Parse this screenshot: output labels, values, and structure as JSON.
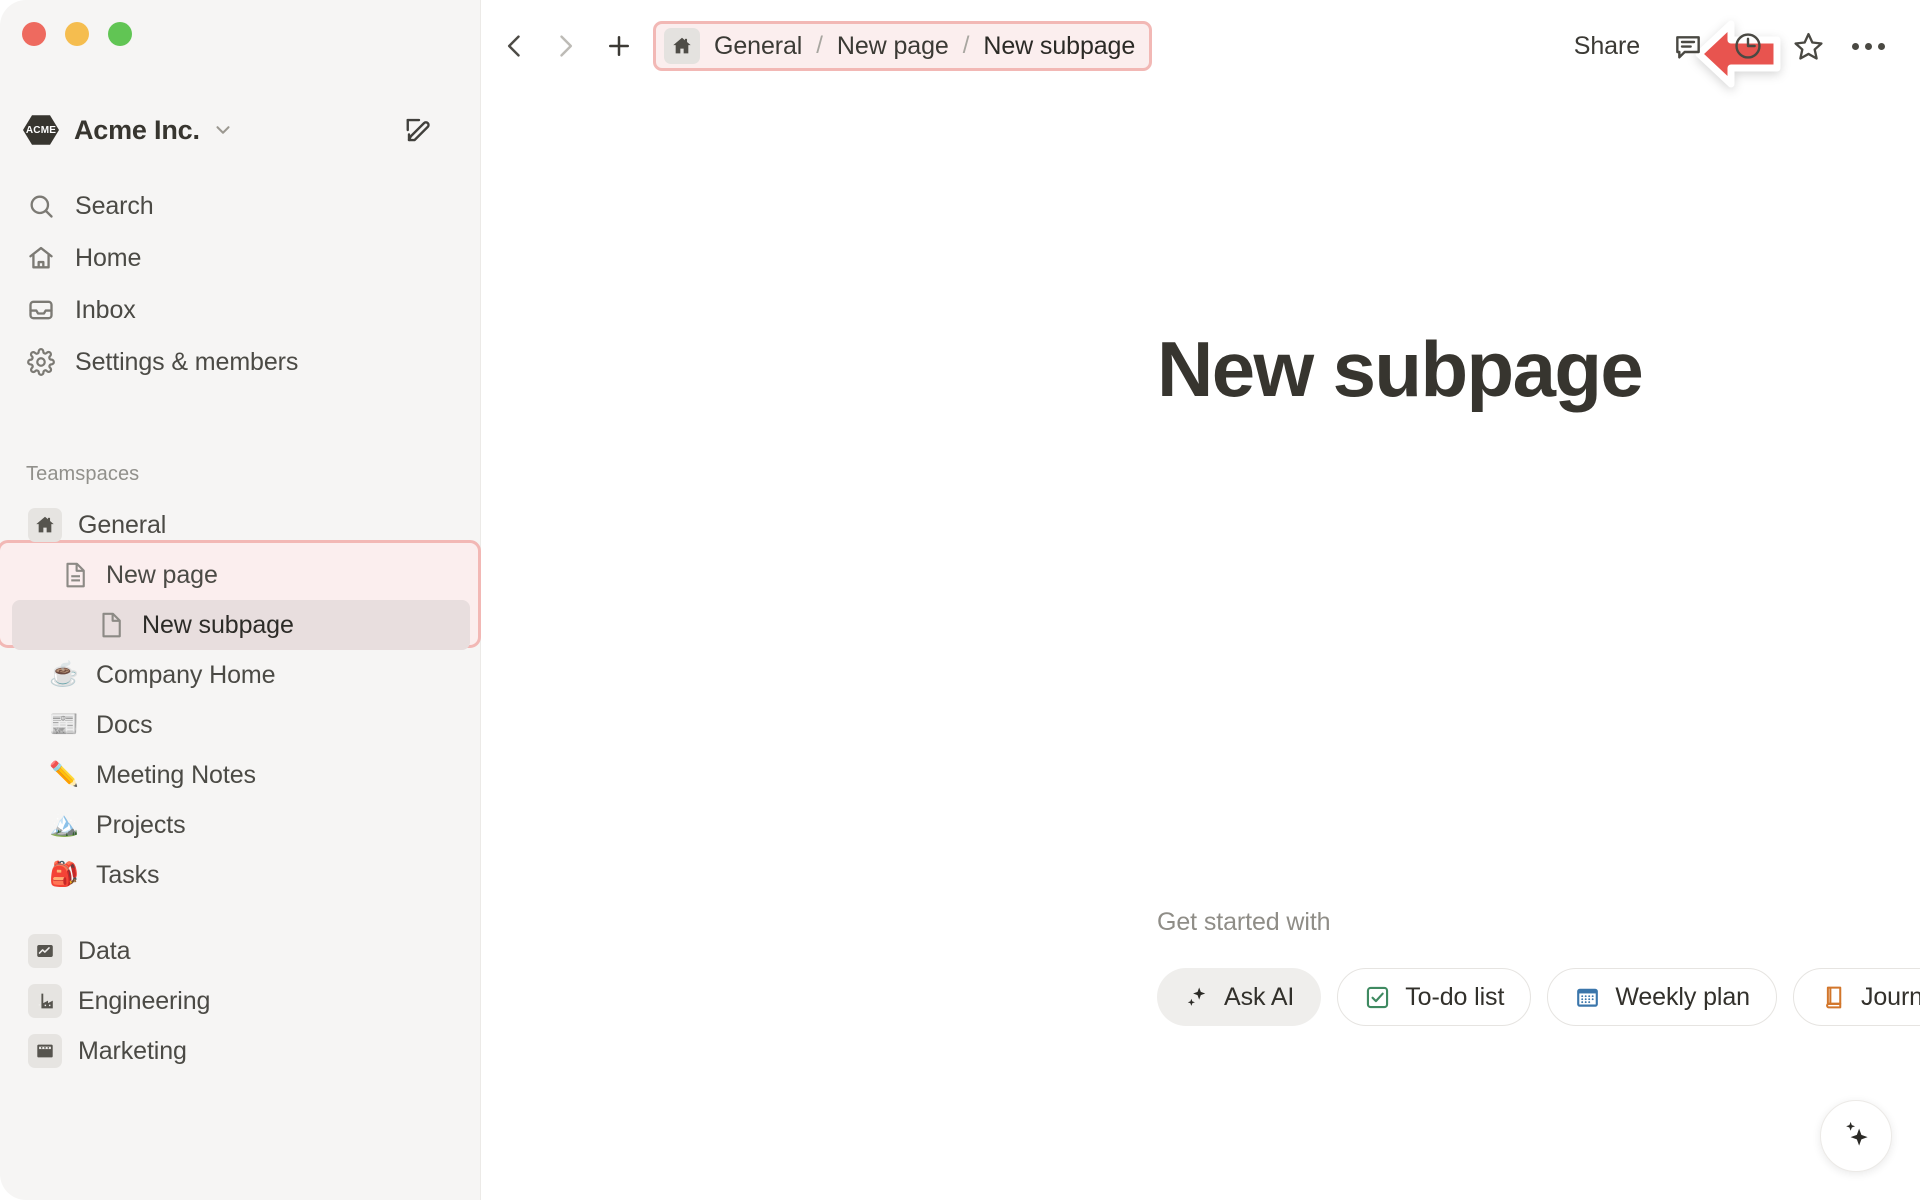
{
  "window": {
    "traffic_lights": [
      {
        "name": "close",
        "color": "#ee6a5f"
      },
      {
        "name": "minimize",
        "color": "#f5bd4f"
      },
      {
        "name": "maximize",
        "color": "#61c554"
      }
    ]
  },
  "sidebar": {
    "workspace": {
      "logo_text": "ACME",
      "name": "Acme Inc.",
      "caret_icon": "chevron-down-icon",
      "edit_icon": "compose-icon"
    },
    "nav": [
      {
        "label": "Search",
        "icon": "search-icon"
      },
      {
        "label": "Home",
        "icon": "home-icon"
      },
      {
        "label": "Inbox",
        "icon": "inbox-icon"
      },
      {
        "label": "Settings & members",
        "icon": "gear-icon"
      }
    ],
    "section_label": "Teamspaces",
    "teamspace": {
      "label": "General",
      "icon": "house-icon"
    },
    "pages": [
      {
        "label": "New page",
        "icon": "page-icon",
        "highlighted": true
      },
      {
        "label": "New subpage",
        "icon": "page-blank-icon",
        "selected": true
      }
    ],
    "emoji_items": [
      {
        "label": "Company Home",
        "emoji": "☕"
      },
      {
        "label": "Docs",
        "emoji": "📰"
      },
      {
        "label": "Meeting Notes",
        "emoji": "✏️"
      },
      {
        "label": "Projects",
        "emoji": "🏔️"
      },
      {
        "label": "Tasks",
        "emoji": "🎒"
      }
    ],
    "spaces": [
      {
        "label": "Data",
        "icon": "chart-icon"
      },
      {
        "label": "Engineering",
        "icon": "factory-icon"
      },
      {
        "label": "Marketing",
        "icon": "billboard-icon"
      }
    ]
  },
  "topbar": {
    "back_icon": "chevron-left-icon",
    "forward_icon": "chevron-right-icon",
    "add_icon": "plus-icon",
    "breadcrumb": {
      "home_icon": "house-icon",
      "items": [
        "General",
        "New page",
        "New subpage"
      ],
      "separator": "/"
    },
    "annotation": {
      "icon": "red-arrow-left",
      "color": "#e8544f"
    },
    "share_label": "Share",
    "actions": [
      {
        "name": "comment-icon"
      },
      {
        "name": "history-icon"
      },
      {
        "name": "star-icon"
      },
      {
        "name": "more-options-icon"
      }
    ]
  },
  "main": {
    "title": "New subpage",
    "get_started_label": "Get started with",
    "chips": [
      {
        "label": "Ask AI",
        "icon": "sparkle-icon",
        "style": "filled"
      },
      {
        "label": "To-do list",
        "icon": "checkbox-icon",
        "style": "outline"
      },
      {
        "label": "Weekly plan",
        "icon": "calendar-icon",
        "style": "outline"
      },
      {
        "label": "Journal",
        "icon": "book-icon",
        "style": "outline"
      }
    ],
    "more_icon": "ellipsis-icon",
    "ai_fab_icon": "sparkles-icon"
  },
  "colors": {
    "accent_highlight_border": "#f2b8b5",
    "accent_highlight_fill": "#fbeeee",
    "arrow_red": "#e8544f",
    "sidebar_bg": "#f6f5f4",
    "text_primary": "#37352f"
  }
}
